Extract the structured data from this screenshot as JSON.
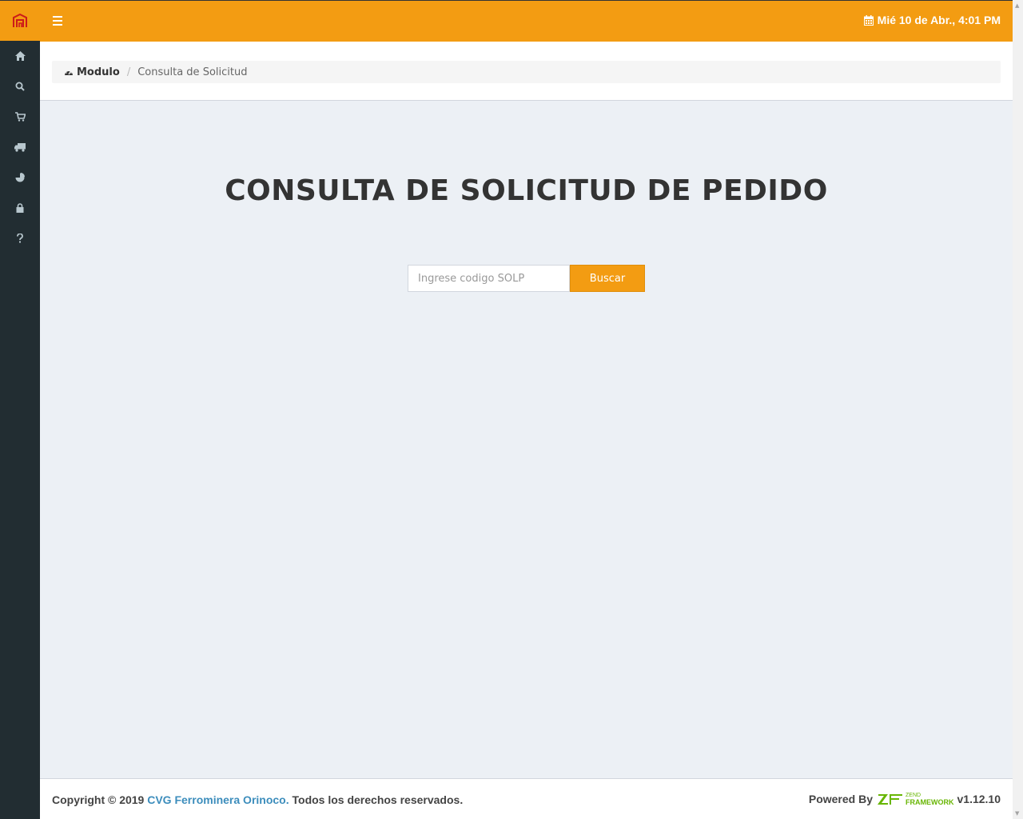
{
  "sidebar": {
    "logo_icon": "ferrominera-logo-icon",
    "items": [
      {
        "icon": "home-icon"
      },
      {
        "icon": "search-icon"
      },
      {
        "icon": "cart-icon"
      },
      {
        "icon": "truck-icon"
      },
      {
        "icon": "pie-chart-icon"
      },
      {
        "icon": "lock-icon"
      },
      {
        "icon": "question-icon"
      }
    ]
  },
  "header": {
    "menu_icon": "hamburger-icon",
    "calendar_icon": "calendar-icon",
    "datetime": "Mié 10 de Abr., 4:01 PM"
  },
  "breadcrumb": {
    "home_icon": "dashboard-icon",
    "home_label": "Modulo",
    "current": "Consulta de Solicitud"
  },
  "main": {
    "title": "CONSULTA DE SOLICITUD DE PEDIDO",
    "search_placeholder": "Ingrese codigo SOLP",
    "search_value": "",
    "search_button": "Buscar"
  },
  "footer": {
    "copyright_prefix": "Copyright © 2019",
    "company_link": "CVG Ferrominera Orinoco.",
    "rights": "Todos los derechos reservados.",
    "powered_by": "Powered By",
    "zend_small": "ZEND",
    "zend_big": "FRAMEWORK",
    "version": "v1.12.10"
  },
  "colors": {
    "accent": "#f39c12",
    "sidebar": "#222d32",
    "background": "#ecf0f5",
    "link": "#3c8dbc",
    "logo_red": "#cc1a1a"
  }
}
